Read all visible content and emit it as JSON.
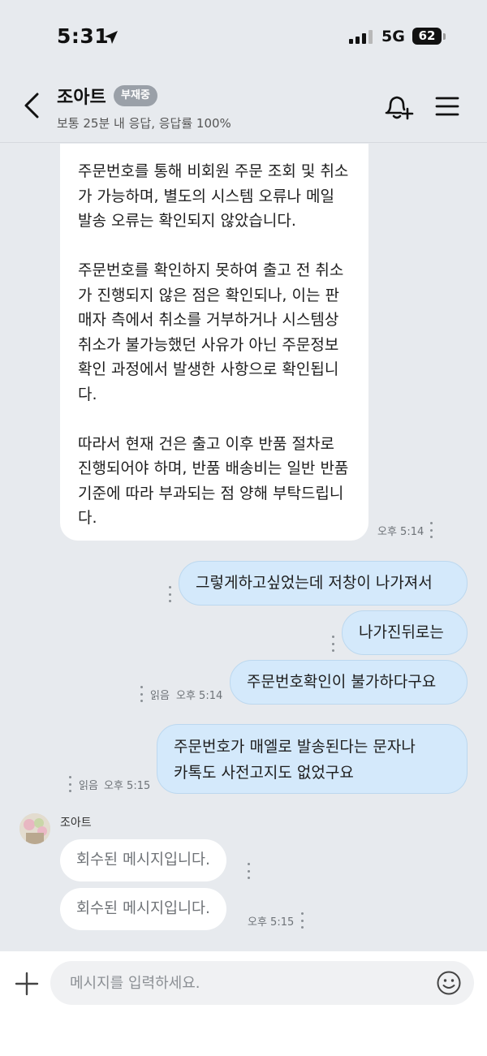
{
  "status_bar": {
    "time": "5:31",
    "network": "5G",
    "battery": "62"
  },
  "header": {
    "title": "조아트",
    "away_badge": "부재중",
    "subtitle": "보통 25분 내 응답, 응답률 100%"
  },
  "messages": {
    "long_message": {
      "paragraphs": [
        "주문번호를 통해 비회원 주문 조회 및 취소가 가능하며, 별도의 시스템 오류나 메일 발송 오류는 확인되지 않았습니다.",
        "주문번호를 확인하지 못하여 출고 전 취소가 진행되지 않은 점은 확인되나, 이는 판매자 측에서 취소를 거부하거나 시스템상 취소가 불가능했던 사유가 아닌 주문정보 확인 과정에서 발생한 사항으로 확인됩니다.",
        "따라서 현재 건은 출고 이후 반품 절차로 진행되어야 하며, 반품 배송비는 일반 반품 기준에 따라 부과되는 점 양해 부탁드립니다."
      ],
      "time": "오후 5:14"
    },
    "outgoing": [
      {
        "text": "그렇게하고싶었는데 저창이 나가져서"
      },
      {
        "text": "나가진뒤로는"
      },
      {
        "text": "주문번호확인이 불가하다구요",
        "read": "읽음",
        "time": "오후 5:14"
      },
      {
        "line1": "주문번호가 매엘로 발송된다는 문자나",
        "line2": "카톡도 사전고지도 없었구요",
        "read": "읽음",
        "time": "오후 5:15"
      }
    ],
    "sender_name": "조아트",
    "recalled": [
      {
        "text": "회수된 메시지입니다."
      },
      {
        "text": "회수된 메시지입니다.",
        "time": "오후 5:15"
      }
    ]
  },
  "input": {
    "placeholder": "메시지를 입력하세요."
  },
  "colors": {
    "background": "#e7eaee",
    "outgoing_bubble": "#d4e9fb",
    "incoming_bubble": "#ffffff",
    "away_badge": "#9aa0a8"
  }
}
